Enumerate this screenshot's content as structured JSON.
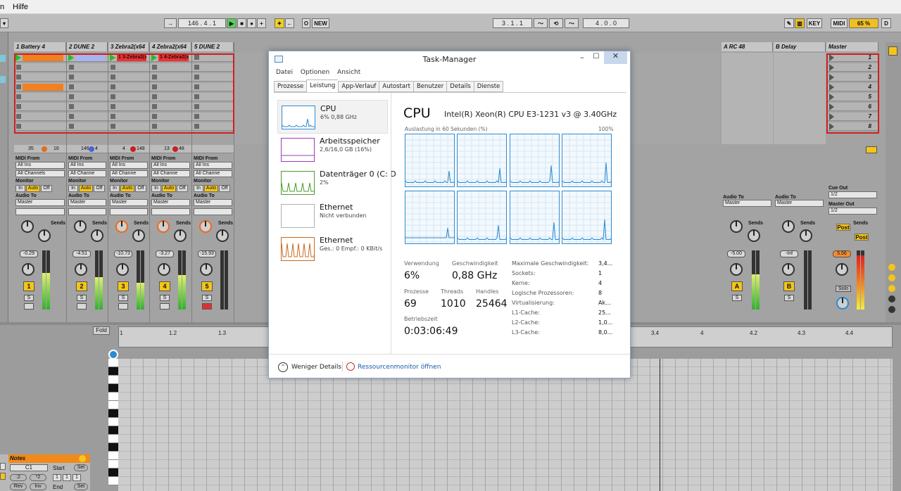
{
  "menubar": {
    "items": [
      "n",
      "Hilfe"
    ]
  },
  "transport": {
    "arrow": "→",
    "position": "146 .  4 .  1",
    "o_label": "O",
    "new_label": "NEW",
    "loop_start": "3 .  1 .  1",
    "loop_length": "4 .  0 .  0",
    "key_label": "KEY",
    "midi_label": "MIDI",
    "cpu_percent": "65 %",
    "d_label": "D"
  },
  "tracks": [
    {
      "name": "1 Battery 4",
      "clip_color": "#f08020",
      "clips": [
        true,
        false,
        false,
        true,
        false,
        false,
        false,
        false
      ],
      "playing": [
        true,
        false,
        false,
        false,
        false,
        false,
        false,
        false
      ],
      "clip_name": "",
      "sends_a": "35",
      "sends_b": "16",
      "vol": "-0.29",
      "num": "1",
      "meter": 0.62
    },
    {
      "name": "2 DUNE 2",
      "clip_color": "#a8b4f0",
      "clips": [
        true,
        false,
        false,
        false,
        false,
        false,
        false,
        false
      ],
      "playing": [
        true,
        false,
        false,
        false,
        false,
        false,
        false,
        false
      ],
      "clip_name": "",
      "sends_a": "146",
      "sends_b": "4",
      "vol": "-4.51",
      "num": "2",
      "meter": 0.55
    },
    {
      "name": "3 Zebra2(x64",
      "clip_color": "#f03030",
      "clips": [
        true,
        false,
        false,
        false,
        false,
        false,
        false,
        false
      ],
      "playing": [
        true,
        false,
        false,
        false,
        false,
        false,
        false,
        false
      ],
      "clip_name": "1 3-Zebra2(x",
      "sends_a": "4",
      "sends_b": "148",
      "vol": "-10.73",
      "num": "3",
      "meter": 0.45
    },
    {
      "name": "4 Zebra2(x64",
      "clip_color": "#f03030",
      "clips": [
        true,
        false,
        false,
        false,
        false,
        false,
        false,
        false
      ],
      "playing": [
        true,
        false,
        false,
        false,
        false,
        false,
        false,
        false
      ],
      "clip_name": "1 4-Zebra2(x",
      "sends_a": "13",
      "sends_b": "48",
      "vol": "-3.27",
      "num": "4",
      "meter": 0.58
    },
    {
      "name": "5 DUNE 2",
      "clip_color": "#b4b4b4",
      "clips": [
        false,
        false,
        false,
        false,
        false,
        false,
        false,
        false
      ],
      "playing": [
        false,
        false,
        false,
        false,
        false,
        false,
        false,
        false
      ],
      "clip_name": "",
      "sends_a": "",
      "sends_b": "",
      "vol": "-15.93",
      "num": "5",
      "meter": 0.0
    }
  ],
  "returns": [
    {
      "name": "A RC 48",
      "vol": "-5.00",
      "letter": "A"
    },
    {
      "name": "B Delay",
      "vol": "-Inf",
      "letter": "B"
    }
  ],
  "master": {
    "name": "Master",
    "scenes": [
      "1",
      "2",
      "3",
      "4",
      "5",
      "6",
      "7",
      "8"
    ],
    "vol": "5.56",
    "post_label": "Post",
    "solo_label": "Solo",
    "cue_out_label": "Cue Out",
    "cue_out_value": "1/2",
    "master_out_label": "Master Out",
    "master_out_value": "1/2"
  },
  "io_labels": {
    "midi_from": "MIDI From",
    "all_ins": "All Ins",
    "all_channels": "All Channels",
    "all_channe": "All Channe",
    "monitor": "Monitor",
    "mon_in": "In",
    "mon_auto": "Auto",
    "mon_off": "Off",
    "audio_to": "Audio To",
    "master": "Master",
    "sends": "Sends",
    "s_label": "S"
  },
  "scale_ticks": [
    "6",
    "0",
    "6",
    "12",
    "24",
    "36",
    "60"
  ],
  "arrangement": {
    "fold_label": "Fold",
    "bars": [
      "1",
      "1.2",
      "1.3",
      "3.4",
      "4",
      "4.2",
      "4.3",
      "4.4"
    ],
    "notes_label": "Notes",
    "note_value": "C1",
    "start_label": "Start",
    "end_label": "End",
    "set_label": "Set",
    "start_values": [
      "1",
      "1",
      "1"
    ],
    "rev_label": "Rev",
    "inv_label": "Inv",
    "minus2_label": ":2",
    "times2_label": "*2"
  },
  "taskmanager": {
    "title": "Task-Manager",
    "menu": [
      "Datei",
      "Optionen",
      "Ansicht"
    ],
    "tabs": [
      "Prozesse",
      "Leistung",
      "App-Verlauf",
      "Autostart",
      "Benutzer",
      "Details",
      "Dienste"
    ],
    "active_tab": "Leistung",
    "sidebar": [
      {
        "title": "CPU",
        "sub": "6% 0,88 GHz",
        "color": "#2e8bd0"
      },
      {
        "title": "Arbeitsspeicher",
        "sub": "2,6/16,0 GB (16%)",
        "color": "#9c3cb4"
      },
      {
        "title": "Datenträger 0 (C: D",
        "sub": "2%",
        "color": "#4a9c28"
      },
      {
        "title": "Ethernet",
        "sub": "Nicht verbunden",
        "color": "#b0b0b0"
      },
      {
        "title": "Ethernet",
        "sub": "Ges.: 0 Empf.: 0 KBit/s",
        "color": "#c86a1c"
      }
    ],
    "cpu_heading": "CPU",
    "cpu_model": "Intel(R) Xeon(R) CPU E3-1231 v3 @ 3.40GHz",
    "graph_caption": "Auslastung in 60 Sekunden (%)",
    "graph_max": "100%",
    "stats": {
      "usage_label": "Verwendung",
      "usage": "6%",
      "speed_label": "Geschwindigkeit",
      "speed": "0,88 GHz",
      "proc_label": "Prozesse",
      "proc": "69",
      "threads_label": "Threads",
      "threads": "1010",
      "handles_label": "Handles",
      "handles": "25464",
      "uptime_label": "Betriebszeit",
      "uptime": "0:03:06:49"
    },
    "details": [
      {
        "k": "Maximale Geschwindigkeit:",
        "v": "3,4..."
      },
      {
        "k": "Sockets:",
        "v": "1"
      },
      {
        "k": "Kerne:",
        "v": "4"
      },
      {
        "k": "Logische Prozessoren:",
        "v": "8"
      },
      {
        "k": "Virtualisierung:",
        "v": "Ak..."
      },
      {
        "k": "L1-Cache:",
        "v": "25..."
      },
      {
        "k": "L2-Cache:",
        "v": "1,0..."
      },
      {
        "k": "L3-Cache:",
        "v": "8,0..."
      }
    ],
    "fewer_details": "Weniger Details",
    "resource_monitor": "Ressourcenmonitor öffnen"
  }
}
